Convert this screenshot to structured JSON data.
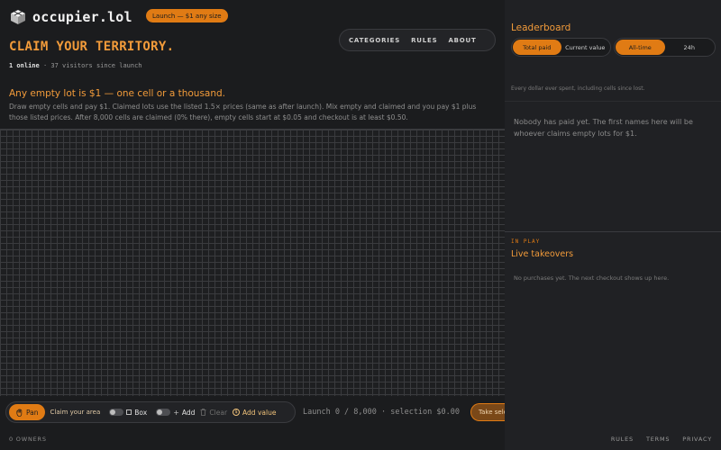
{
  "header": {
    "brand": "occupier.lol",
    "launch_badge": "Launch — $1 any size",
    "headline": "CLAIM YOUR TERRITORY.",
    "online": "1 online",
    "visitors": "· 37 visitors since launch",
    "nav": [
      "CATEGORIES",
      "RULES",
      "ABOUT"
    ],
    "icons": {
      "logo": "cube-logo-icon",
      "theme": "sun-icon"
    }
  },
  "offer": {
    "title": "Any empty lot is $1 — one cell or a thousand.",
    "description": "Draw empty cells and pay $1. Claimed lots use the listed 1.5× prices (same as after launch). Mix empty and claimed and you pay $1 plus those listed prices. After 8,000 cells are claimed (0% there), empty cells start at $0.05 and checkout is at least $0.50."
  },
  "toolbar": {
    "pan": "Pan",
    "claim_area": "Claim your area",
    "box": "Box",
    "add": "Add",
    "clear": "Clear",
    "add_value": "Add value",
    "counter": "Launch 0 / 8,000 · selection $0.00",
    "take": "Take selection"
  },
  "footer": {
    "owners": "0 OWNERS",
    "links": [
      "RULES",
      "TERMS",
      "PRIVACY"
    ]
  },
  "leaderboard": {
    "title": "Leaderboard",
    "metric_tabs": [
      "Total paid",
      "Current value"
    ],
    "period_tabs": [
      "All-time",
      "24h"
    ],
    "note": "Every dollar ever spent, including cells since lost.",
    "empty": "Nobody has paid yet. The first names here will be whoever claims empty lots for $1."
  },
  "takeovers": {
    "eyebrow": "IN PLAY",
    "title": "Live takeovers",
    "empty": "No purchases yet. The next checkout shows up here."
  },
  "colors": {
    "accent": "#e07b14",
    "accent_text": "#f29b3a",
    "background": "#1b1c1e",
    "panel": "#202124"
  }
}
